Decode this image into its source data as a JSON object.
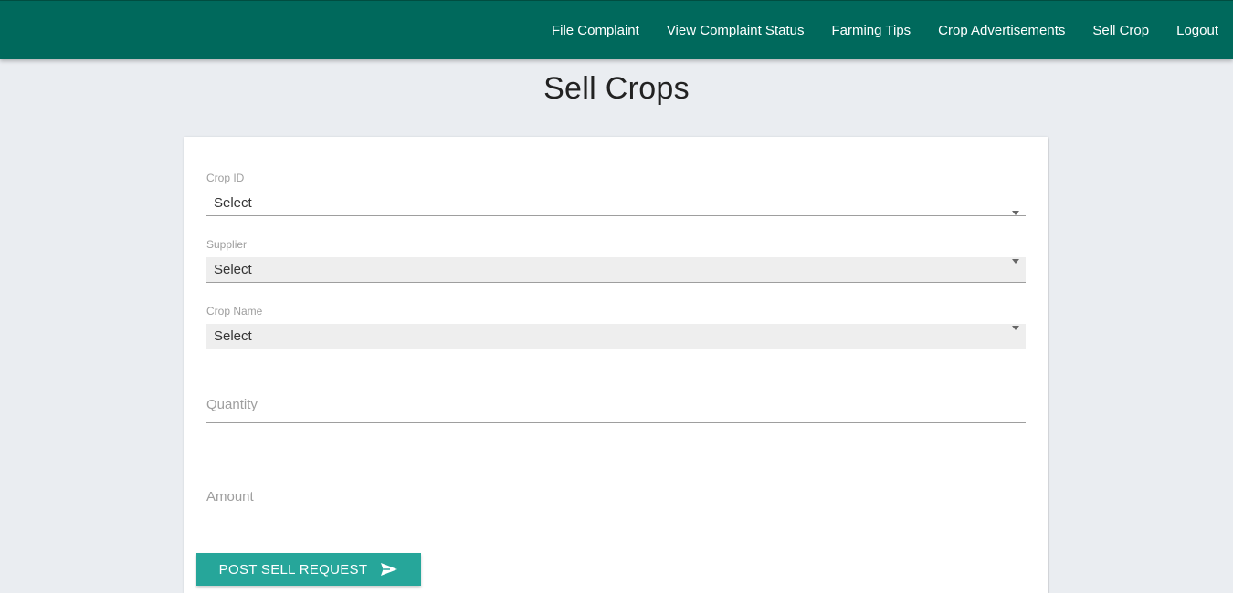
{
  "nav": {
    "items": [
      {
        "label": "File Complaint"
      },
      {
        "label": "View Complaint Status"
      },
      {
        "label": "Farming Tips"
      },
      {
        "label": "Crop Advertisements"
      },
      {
        "label": "Sell Crop"
      },
      {
        "label": "Logout"
      }
    ]
  },
  "page": {
    "title": "Sell Crops"
  },
  "form": {
    "crop_id": {
      "label": "Crop ID",
      "value": "Select"
    },
    "supplier": {
      "label": "Supplier",
      "value": "Select"
    },
    "crop_name": {
      "label": "Crop Name",
      "value": "Select"
    },
    "quantity": {
      "placeholder": "Quantity",
      "value": ""
    },
    "amount": {
      "placeholder": "Amount",
      "value": ""
    },
    "submit_label": "POST SELL REQUEST",
    "submit_icon": "send-icon"
  },
  "colors": {
    "navbar": "#00695c",
    "button": "#26a69a",
    "background": "#eaedf1"
  }
}
